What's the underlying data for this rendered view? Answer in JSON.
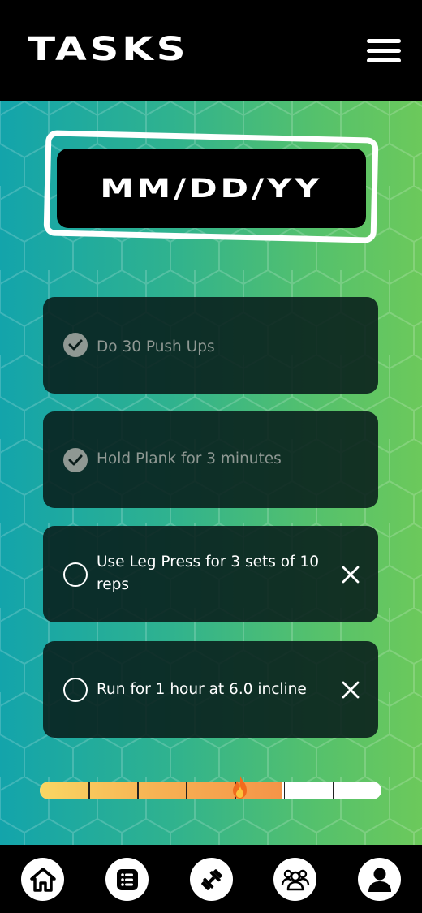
{
  "header": {
    "title": "TASKS",
    "menu_icon": "hamburger-menu-icon"
  },
  "date": {
    "placeholder": "MM/DD/YY"
  },
  "tasks": [
    {
      "label": "Do 30 Push Ups",
      "completed": true
    },
    {
      "label": "Hold Plank for 3 minutes",
      "completed": true
    },
    {
      "label": "Use Leg Press for 3 sets of 10 reps",
      "completed": false
    },
    {
      "label": "Run for 1 hour at 6.0 incline",
      "completed": false
    }
  ],
  "progress": {
    "fraction": 0.71,
    "segments": 7,
    "icon": "fire-icon"
  },
  "bottom_nav": [
    {
      "name": "home",
      "icon": "home-icon"
    },
    {
      "name": "tasks",
      "icon": "list-icon"
    },
    {
      "name": "workouts",
      "icon": "dumbbell-icon"
    },
    {
      "name": "community",
      "icon": "group-icon"
    },
    {
      "name": "profile",
      "icon": "user-icon"
    }
  ],
  "colors": {
    "gradient_start": "#13a4ab",
    "gradient_end": "#6cc95b",
    "task_card": "#0a1c1a",
    "completed_text": "#8f9893",
    "progress_start": "#f9d663",
    "progress_end": "#f59448"
  }
}
